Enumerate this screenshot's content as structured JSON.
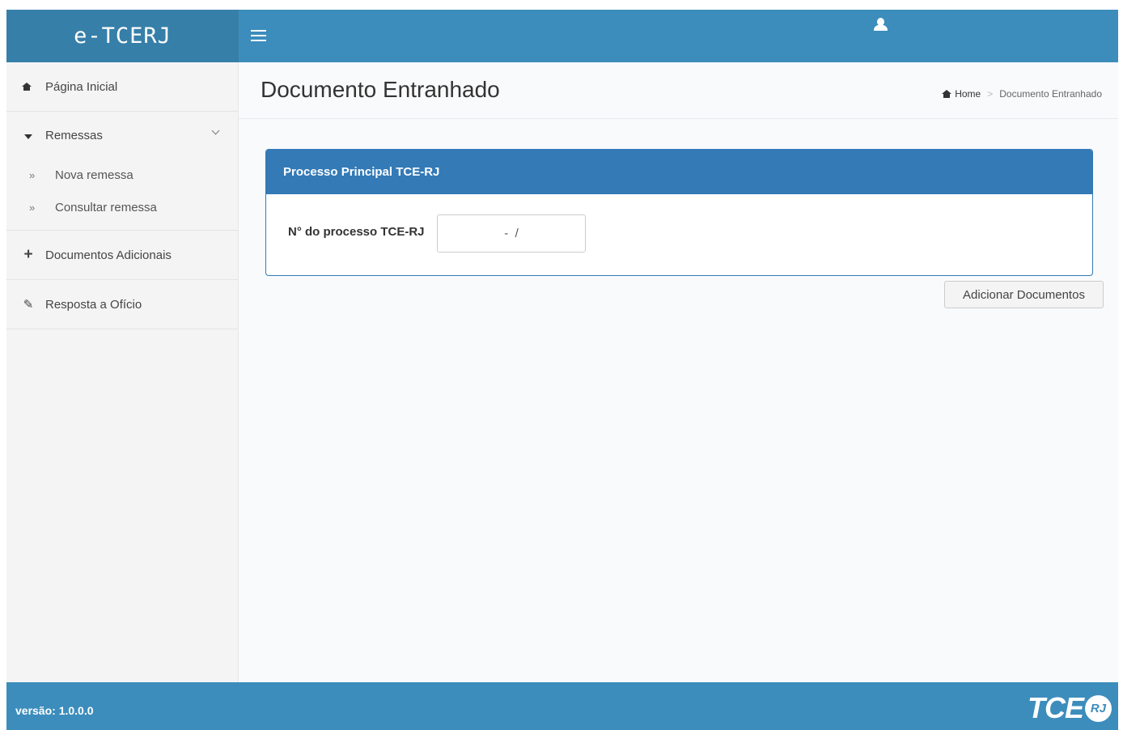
{
  "header": {
    "brand": "e-TCERJ",
    "menu_icon": "hamburger-icon",
    "user_icon": "user-icon"
  },
  "sidebar": {
    "items": [
      {
        "label": "Página Inicial",
        "icon": "home-icon"
      },
      {
        "label": "Remessas",
        "icon": "caret-down-icon",
        "expanded": true,
        "children": [
          {
            "label": "Nova remessa",
            "icon": "double-chevron-right-icon"
          },
          {
            "label": "Consultar remessa",
            "icon": "double-chevron-right-icon"
          }
        ]
      },
      {
        "label": "Documentos Adicionais",
        "icon": "plus-icon"
      },
      {
        "label": "Resposta a Ofício",
        "icon": "edit-icon"
      }
    ]
  },
  "content": {
    "title": "Documento Entranhado",
    "breadcrumb": [
      "Home",
      "Documento Entranhado"
    ]
  },
  "panel": {
    "heading": "Processo Principal TCE-RJ",
    "field_label": "N° do processo TCE-RJ",
    "field_value": "   -  /   ",
    "field_mask": "- /"
  },
  "actions": {
    "add_documents": "Adicionar Documentos"
  },
  "footer": {
    "version": "versão: 1.0.0.0",
    "logo_text": "TCE",
    "logo_seal": "RJ"
  },
  "colors": {
    "header": "#3c8dbc",
    "brand_bg": "#367fa9",
    "panel_primary": "#337ab7",
    "sidebar_bg": "#f4f4f5",
    "content_bg": "#f9fafc"
  }
}
